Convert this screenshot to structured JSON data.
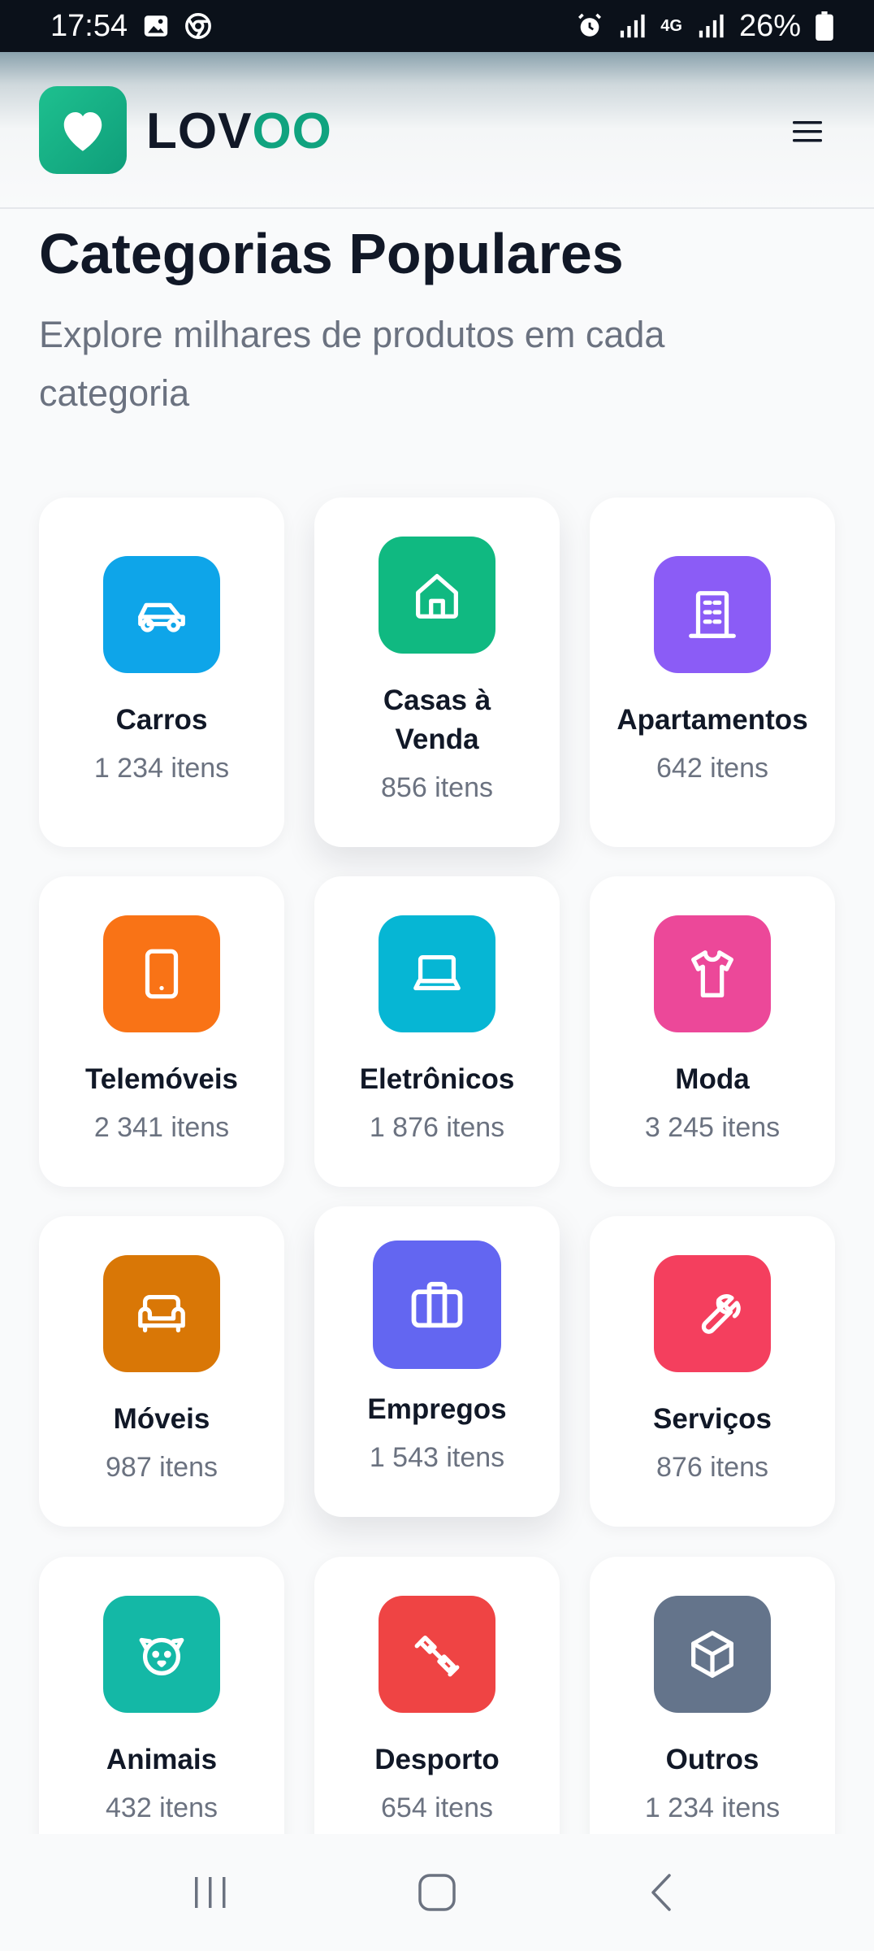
{
  "status_bar": {
    "time": "17:54",
    "network": "4G",
    "battery": "26%"
  },
  "header": {
    "logo_part1": "LOV",
    "logo_part2": "OO",
    "accent_color": "#10a37f"
  },
  "intro": {
    "title": "Categorias Populares",
    "subtitle": "Explore milhares de produtos em cada categoria"
  },
  "categories": [
    {
      "name": "Carros",
      "count": "1 234 itens",
      "icon": "car-icon",
      "color": "#0ea5e9"
    },
    {
      "name": "Casas à Venda",
      "count": "856 itens",
      "icon": "house-icon",
      "color": "#10b981"
    },
    {
      "name": "Apartamentos",
      "count": "642 itens",
      "icon": "building-icon",
      "color": "#8b5cf6"
    },
    {
      "name": "Telemóveis",
      "count": "2 341 itens",
      "icon": "phone-icon",
      "color": "#f97316"
    },
    {
      "name": "Eletrônicos",
      "count": "1 876 itens",
      "icon": "laptop-icon",
      "color": "#06b6d4"
    },
    {
      "name": "Moda",
      "count": "3 245 itens",
      "icon": "shirt-icon",
      "color": "#ec4899"
    },
    {
      "name": "Móveis",
      "count": "987 itens",
      "icon": "sofa-icon",
      "color": "#d97706"
    },
    {
      "name": "Empregos",
      "count": "1 543 itens",
      "icon": "briefcase-icon",
      "color": "#6366f1"
    },
    {
      "name": "Serviços",
      "count": "876 itens",
      "icon": "wrench-icon",
      "color": "#f43f5e"
    },
    {
      "name": "Animais",
      "count": "432 itens",
      "icon": "dog-icon",
      "color": "#14b8a6"
    },
    {
      "name": "Desporto",
      "count": "654 itens",
      "icon": "dumbbell-icon",
      "color": "#ef4444"
    },
    {
      "name": "Outros",
      "count": "1 234 itens",
      "icon": "box-icon",
      "color": "#64748b"
    }
  ]
}
